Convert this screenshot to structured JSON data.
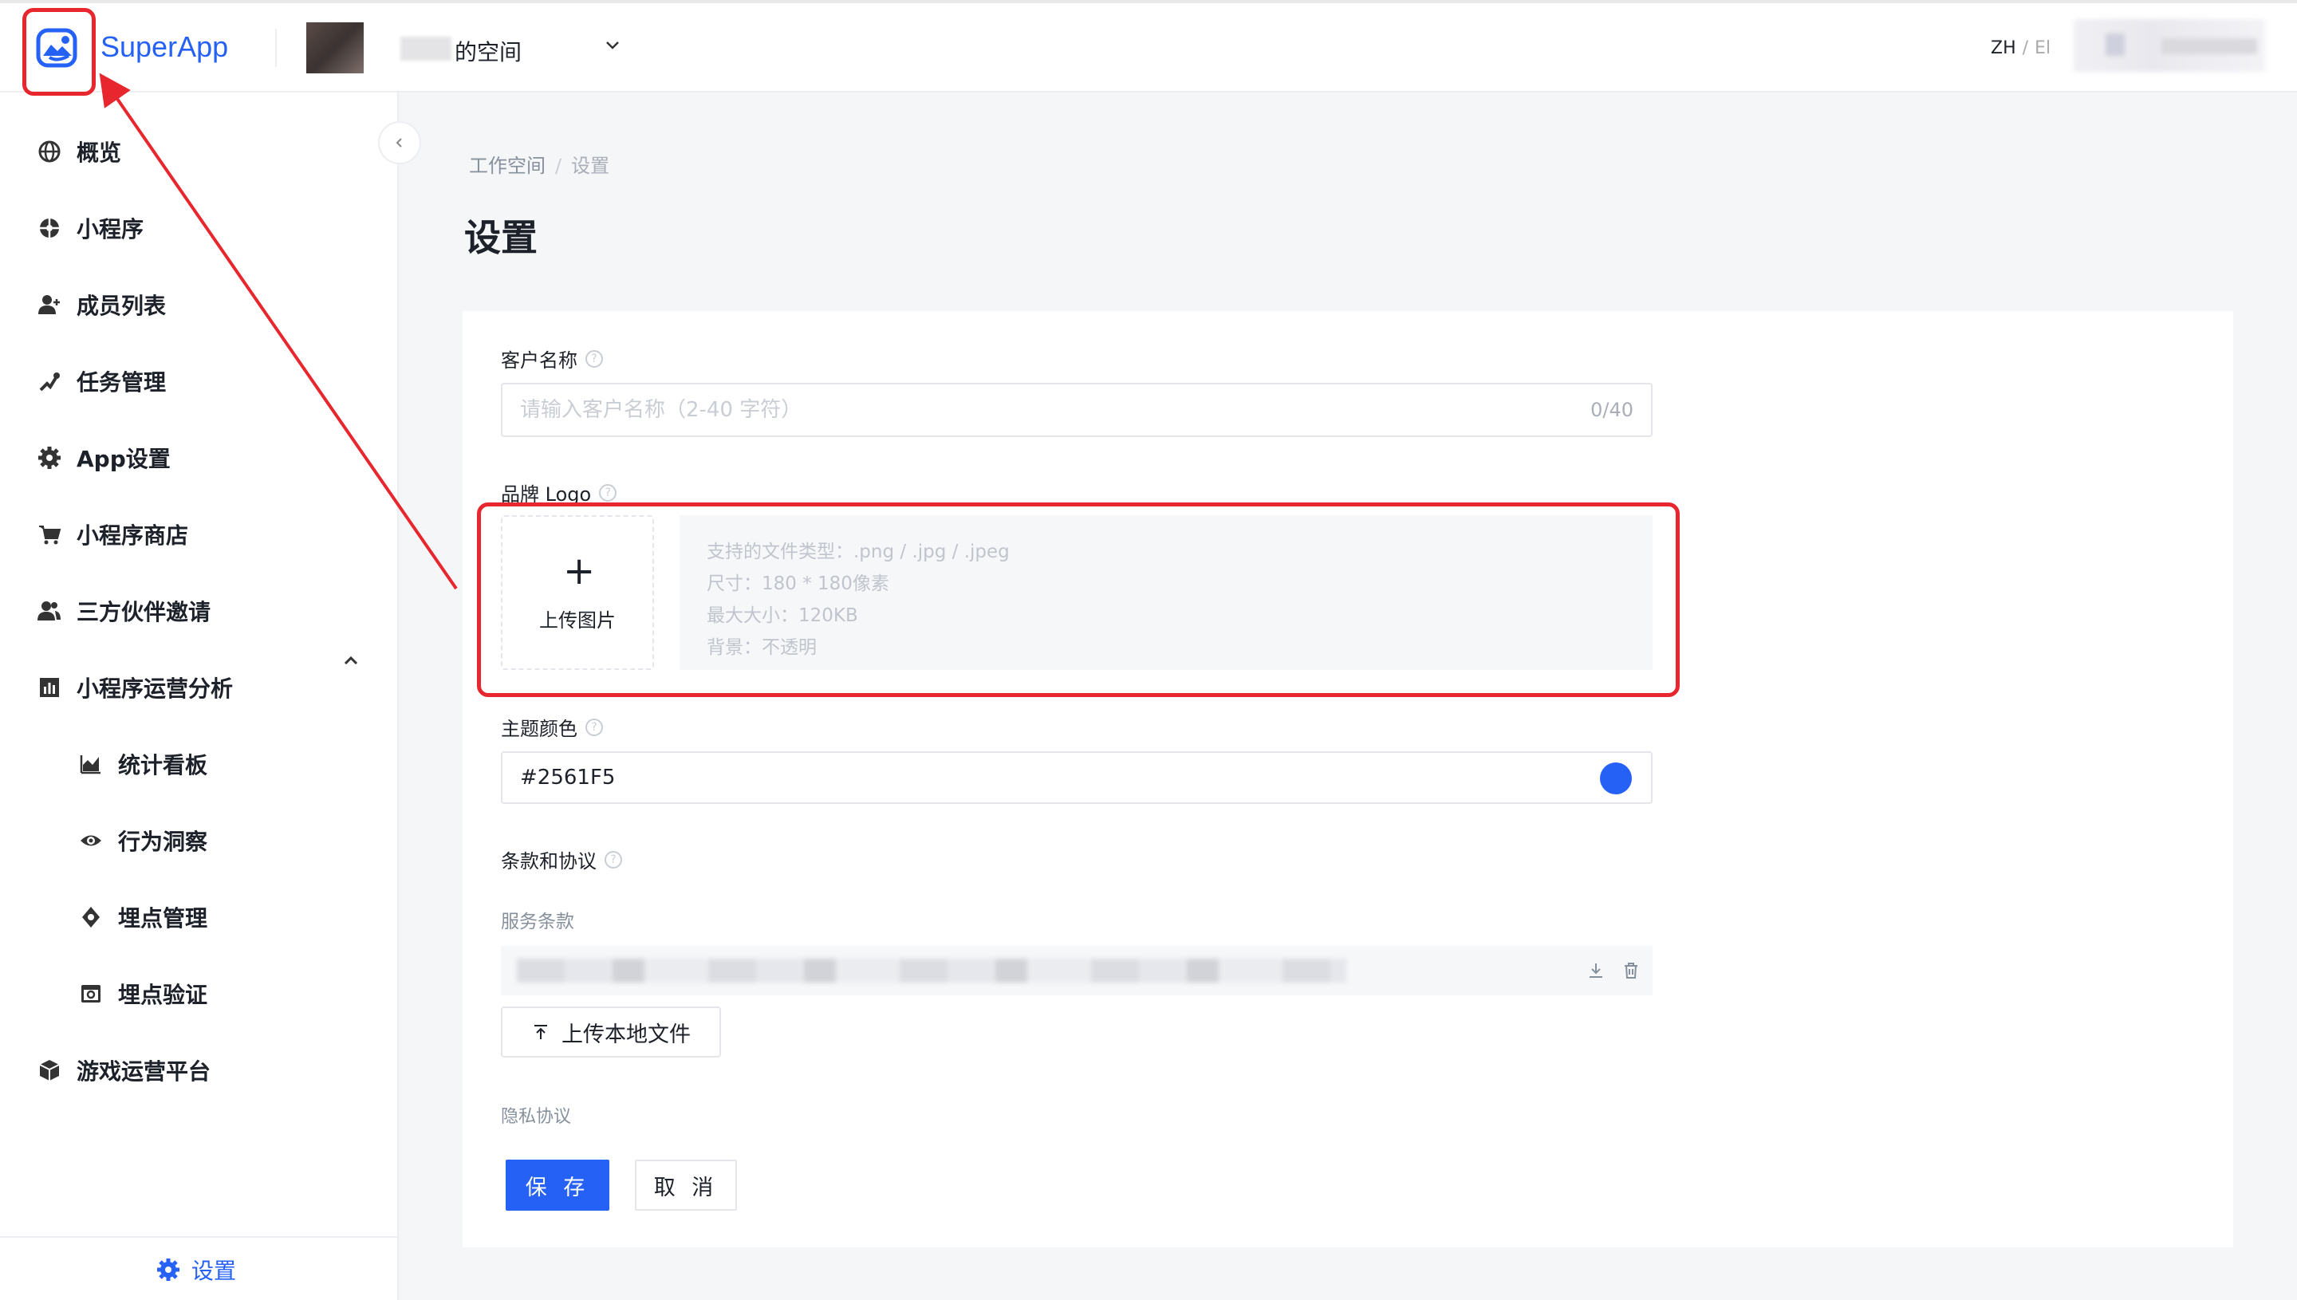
{
  "header": {
    "brand": "SuperApp",
    "workspace_name": "的空间",
    "lang_zh": "ZH",
    "lang_sep": "/",
    "lang_en": "El"
  },
  "sidebar": {
    "items": [
      {
        "label": "概览",
        "icon": "globe-icon"
      },
      {
        "label": "小程序",
        "icon": "miniapp-icon"
      },
      {
        "label": "成员列表",
        "icon": "add-user-icon"
      },
      {
        "label": "任务管理",
        "icon": "task-icon"
      },
      {
        "label": "App设置",
        "icon": "gear-icon"
      },
      {
        "label": "小程序商店",
        "icon": "cart-icon"
      },
      {
        "label": "三方伙伴邀请",
        "icon": "partners-icon"
      },
      {
        "label": "小程序运营分析",
        "icon": "bar-chart-icon"
      },
      {
        "label": "统计看板",
        "icon": "area-chart-icon"
      },
      {
        "label": "行为洞察",
        "icon": "eye-icon"
      },
      {
        "label": "埋点管理",
        "icon": "location-icon"
      },
      {
        "label": "埋点验证",
        "icon": "verify-icon"
      },
      {
        "label": "游戏运营平台",
        "icon": "cube-icon"
      }
    ],
    "footer_label": "设置"
  },
  "breadcrumb": {
    "root": "工作空间",
    "sep": "/",
    "current": "设置"
  },
  "page_title": "设置",
  "form": {
    "customer_name": {
      "label": "客户名称",
      "placeholder": "请输入客户名称（2-40 字符）",
      "value": "",
      "counter": "0/40"
    },
    "brand_logo": {
      "label": "品牌 Logo",
      "upload_label": "上传图片",
      "hints": [
        "支持的文件类型：.png / .jpg / .jpeg",
        "尺寸：180 * 180像素",
        "最大大小：120KB",
        "背景：不透明"
      ]
    },
    "theme_color": {
      "label": "主题颜色",
      "value": "#2561F5"
    },
    "terms": {
      "label": "条款和协议",
      "service_terms_label": "服务条款",
      "upload_local_label": "上传本地文件",
      "privacy_label": "隐私协议"
    },
    "save_label": "保 存",
    "cancel_label": "取 消"
  },
  "colors": {
    "accent": "#2561f5",
    "annotation": "#e8262d"
  }
}
